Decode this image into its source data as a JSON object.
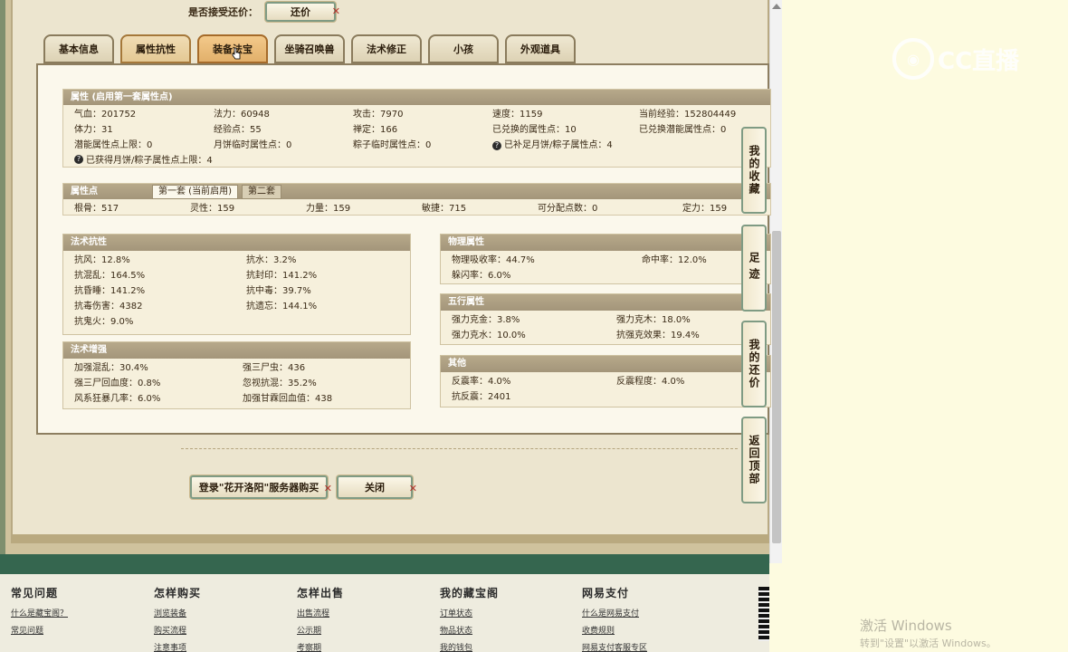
{
  "top": {
    "bargain_label": "是否接受还价：",
    "bargain_button": "还价"
  },
  "tabs": [
    {
      "label": "基本信息",
      "active": false
    },
    {
      "label": "属性抗性",
      "active": false
    },
    {
      "label": "装备法宝",
      "active": true
    },
    {
      "label": "坐骑召唤兽",
      "active": false
    },
    {
      "label": "法术修正",
      "active": false
    },
    {
      "label": "小孩",
      "active": false
    },
    {
      "label": "外观道具",
      "active": false
    }
  ],
  "attributes": {
    "title": "属性 (启用第一套属性点)",
    "rows": [
      [
        "气血：201752",
        "法力：60948",
        "攻击：7970",
        "速度：1159",
        "当前经验：152804449"
      ],
      [
        "体力：31",
        "经验点：55",
        "禅定：166",
        "已兑换的属性点：10",
        "已兑换潜能属性点：0"
      ],
      [
        "潜能属性点上限：0",
        "月饼临时属性点：0",
        "粽子临时属性点：0",
        "已补足月饼/粽子属性点：4",
        ""
      ]
    ],
    "note": "已获得月饼/粽子属性点上限：4"
  },
  "points": {
    "title": "属性点",
    "subtab_active": "第一套 (当前启用)",
    "subtab_inactive": "第二套",
    "values": [
      "根骨：517",
      "灵性：159",
      "力量：159",
      "敏捷：715",
      "可分配点数：0",
      "定力：159"
    ]
  },
  "spell_resist": {
    "title": "法术抗性",
    "rows": [
      [
        "抗风：12.8%",
        "抗水：3.2%"
      ],
      [
        "抗混乱：164.5%",
        "抗封印：141.2%"
      ],
      [
        "抗昏睡：141.2%",
        "抗中毒：39.7%"
      ],
      [
        "抗毒伤害：4382",
        "抗遗忘：144.1%"
      ],
      [
        "抗鬼火：9.0%",
        ""
      ]
    ]
  },
  "spell_enhance": {
    "title": "法术增强",
    "rows": [
      [
        "加强混乱：30.4%",
        "强三尸虫：436"
      ],
      [
        "强三尸回血度：0.8%",
        "忽视抗混：35.2%"
      ],
      [
        "风系狂暴几率：6.0%",
        "加强甘霖回血值：438"
      ]
    ]
  },
  "physical": {
    "title": "物理属性",
    "rows": [
      [
        "物理吸收率：44.7%",
        "命中率：12.0%"
      ],
      [
        "躲闪率：6.0%",
        ""
      ]
    ]
  },
  "five_elements": {
    "title": "五行属性",
    "rows": [
      [
        "强力克金：3.8%",
        "强力克木：18.0%"
      ],
      [
        "强力克水：10.0%",
        "抗强克效果：19.4%"
      ]
    ]
  },
  "others": {
    "title": "其他",
    "rows": [
      [
        "反震率：4.0%",
        "反震程度：4.0%"
      ],
      [
        "抗反震：2401",
        ""
      ]
    ]
  },
  "bottom_buttons": {
    "login": "登录\"花开洛阳\"服务器购买",
    "close": "关闭"
  },
  "side_nav": [
    {
      "label": "我的收藏"
    },
    {
      "label": "足迹"
    },
    {
      "label": "我的还价"
    },
    {
      "label": "返回顶部"
    }
  ],
  "footer": {
    "columns": [
      {
        "title": "常见问题",
        "links": [
          "什么是藏宝阁？",
          "常见问题"
        ]
      },
      {
        "title": "怎样购买",
        "links": [
          "浏览装备",
          "购买流程",
          "注意事项"
        ]
      },
      {
        "title": "怎样出售",
        "links": [
          "出售流程",
          "公示期",
          "考察期"
        ]
      },
      {
        "title": "我的藏宝阁",
        "links": [
          "订单状态",
          "物品状态",
          "我的钱包"
        ]
      },
      {
        "title": "网易支付",
        "links": [
          "什么是网易支付",
          "收费规则",
          "网易支付客服专区"
        ]
      }
    ]
  },
  "overlay": {
    "logo_text": "CC直播",
    "activate_title": "激活 Windows",
    "activate_sub": "转到\"设置\"以激活 Windows。"
  }
}
